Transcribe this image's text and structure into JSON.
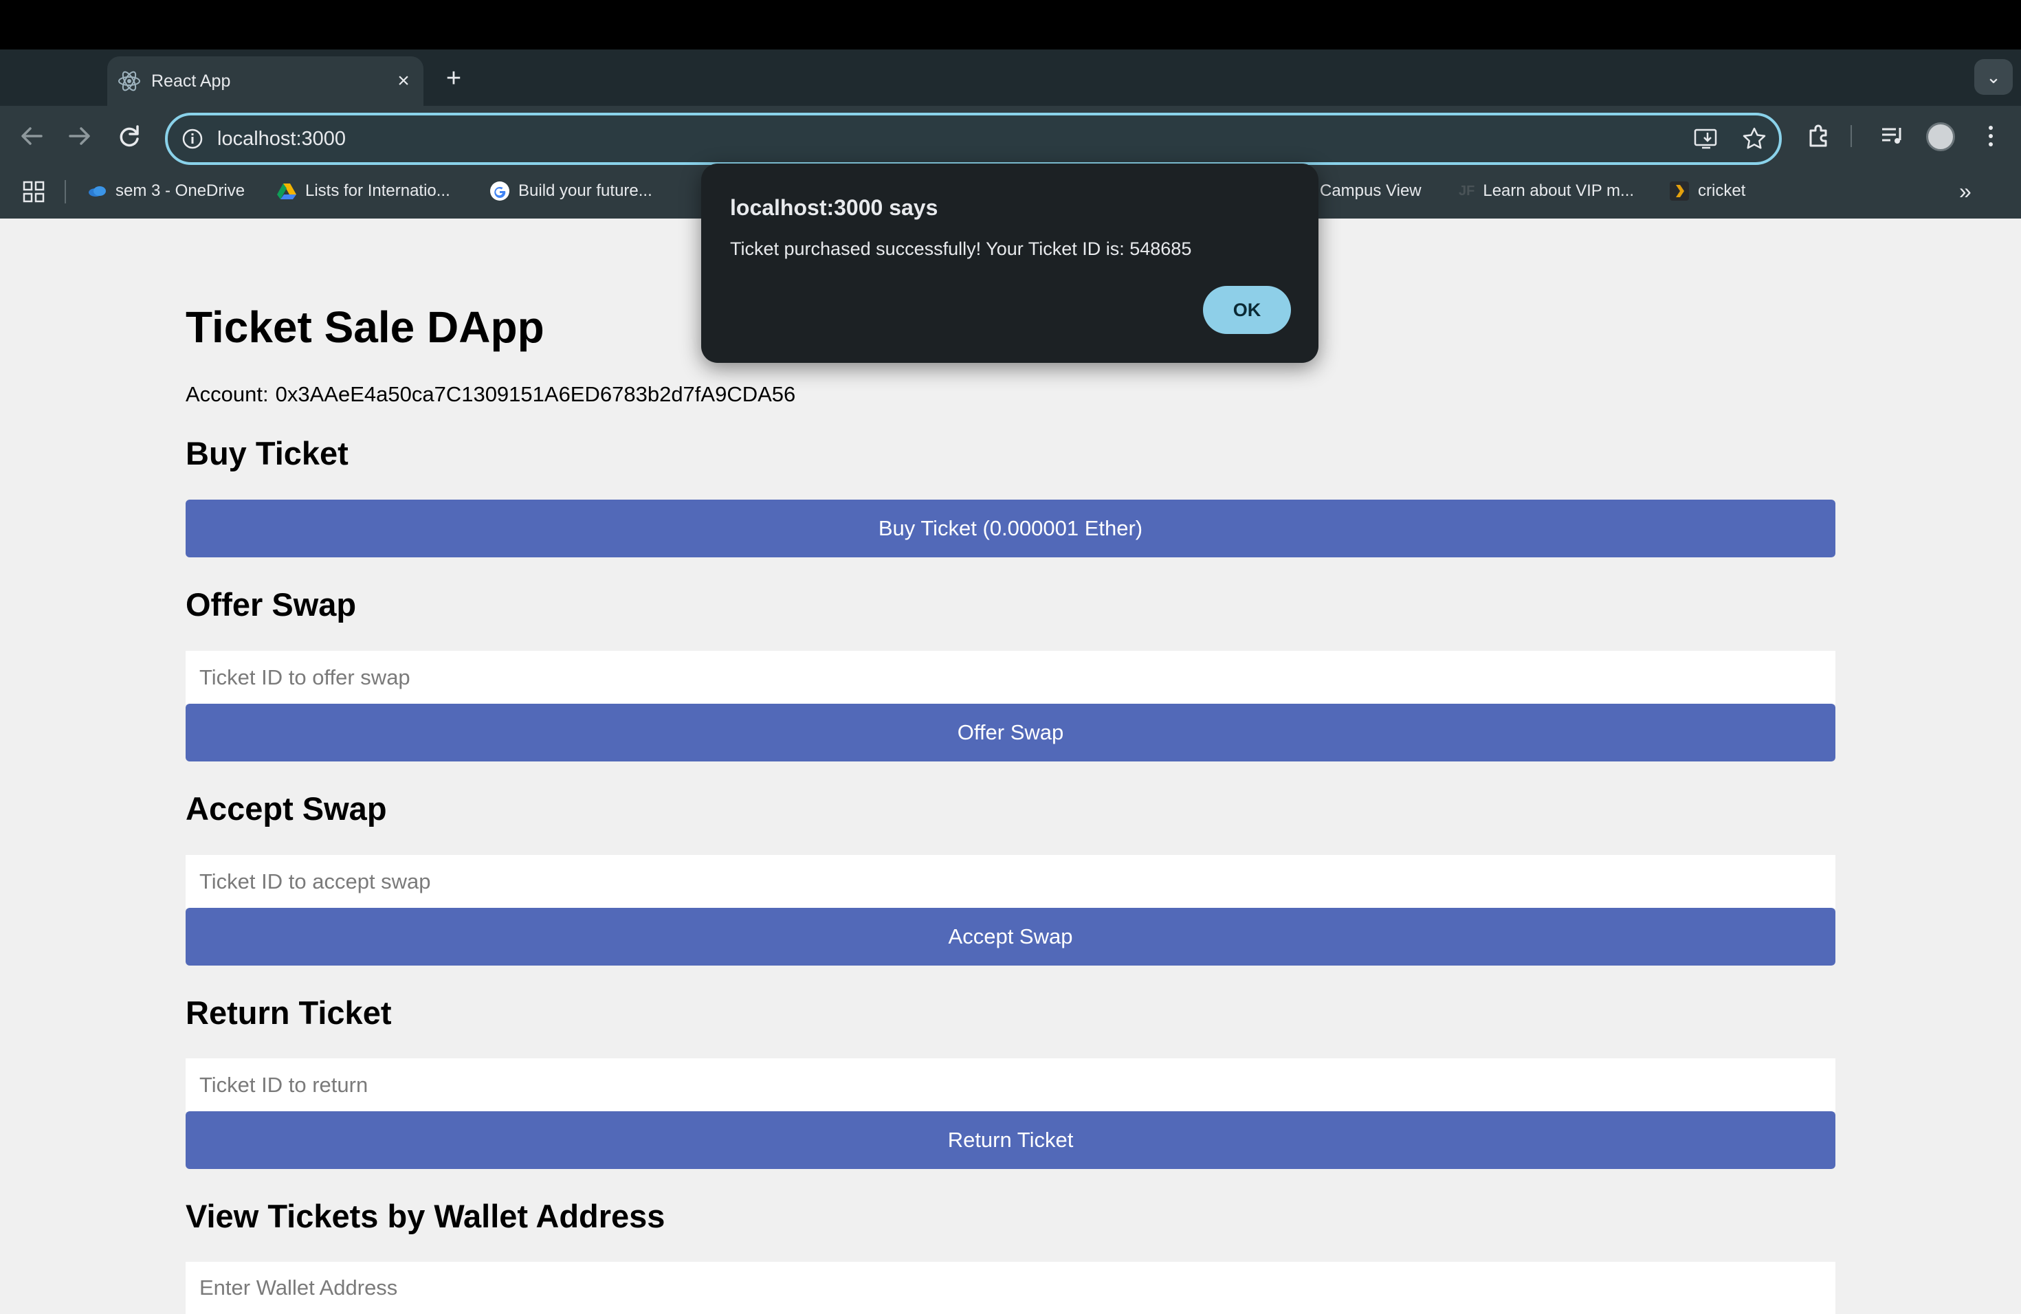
{
  "browser": {
    "tab_title": "React App",
    "url": "localhost:3000",
    "bookmarks": [
      {
        "label": "sem 3 - OneDrive",
        "icon": "onedrive-icon"
      },
      {
        "label": "Lists for Internatio...",
        "icon": "google-drive-icon"
      },
      {
        "label": "Build your future...",
        "icon": "google-icon"
      },
      {
        "label": "Campus View",
        "icon": "campus-icon"
      },
      {
        "label": "Learn about VIP m...",
        "icon": "jf-icon"
      },
      {
        "label": "cricket",
        "icon": "plex-icon"
      }
    ],
    "accent_color": "#8ad2ea"
  },
  "page": {
    "title": "Ticket Sale DApp",
    "account_label": "Account:",
    "account_value": "0x3AAeE4a50ca7C1309151A6ED6783b2d7fA9CDA56",
    "buy": {
      "heading": "Buy Ticket",
      "button": "Buy Ticket (0.000001 Ether)"
    },
    "offer": {
      "heading": "Offer Swap",
      "placeholder": "Ticket ID to offer swap",
      "button": "Offer Swap"
    },
    "accept": {
      "heading": "Accept Swap",
      "placeholder": "Ticket ID to accept swap",
      "button": "Accept Swap"
    },
    "return": {
      "heading": "Return Ticket",
      "placeholder": "Ticket ID to return",
      "button": "Return Ticket"
    },
    "view": {
      "heading": "View Tickets by Wallet Address",
      "placeholder": "Enter Wallet Address"
    },
    "button_color": "#5269b8"
  },
  "dialog": {
    "title": "localhost:3000 says",
    "message": "Ticket purchased successfully! Your Ticket ID is: 548685",
    "ok_label": "OK"
  }
}
